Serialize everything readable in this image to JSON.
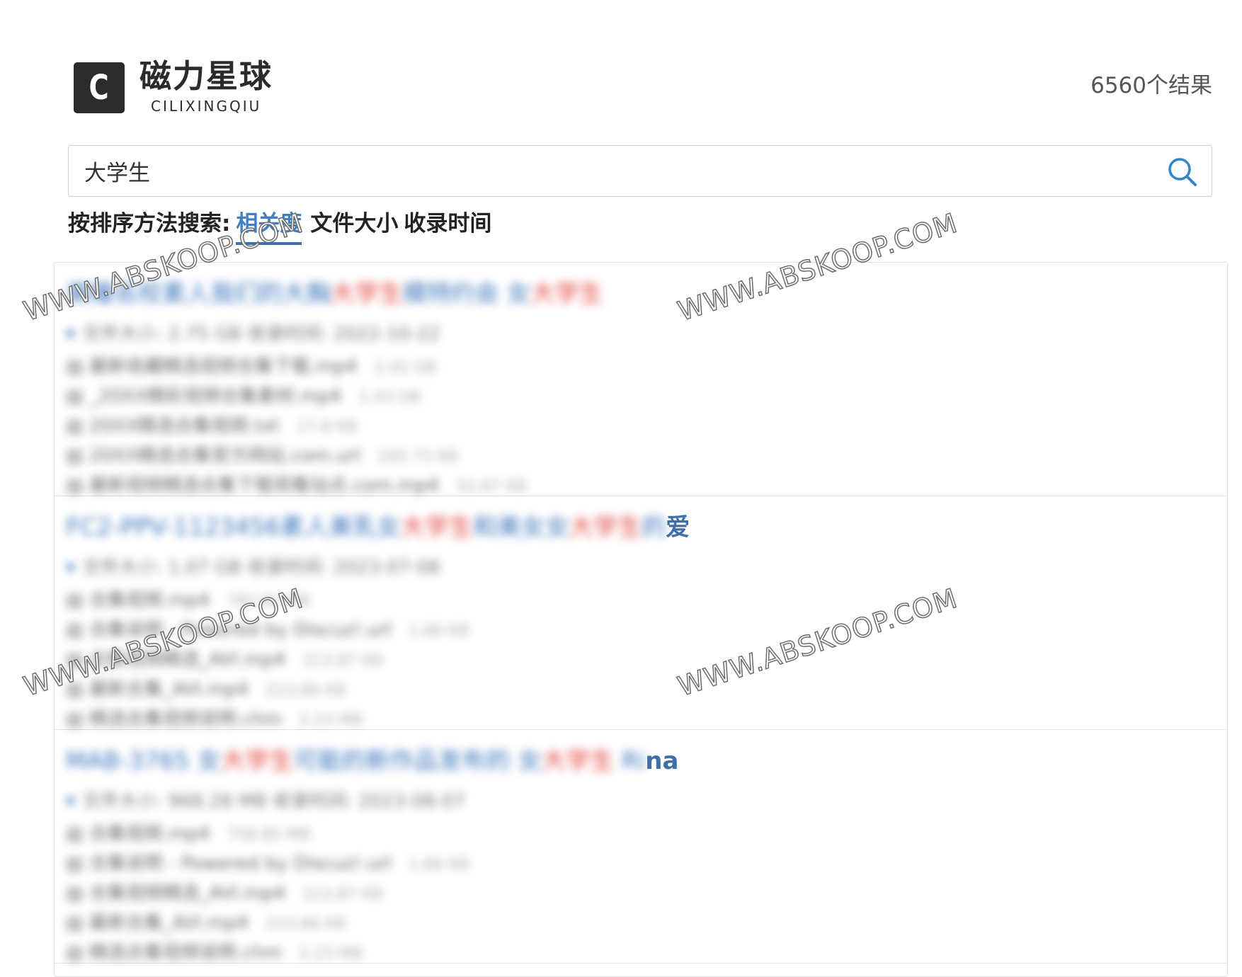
{
  "header": {
    "logo_letter": "C",
    "logo_name_cn": "磁力星球",
    "logo_name_en": "CILIXINGQIU",
    "result_count": "6560个结果"
  },
  "search": {
    "value": "大学生",
    "placeholder": ""
  },
  "sort": {
    "label": "按排序方法搜索:",
    "options": [
      "相关度",
      "文件大小",
      "收录时间"
    ],
    "active": "相关度"
  },
  "results": [
    {
      "title_segments": [
        {
          "text": "美瞳名校素人我们的大胸",
          "style": "blue",
          "blurred": true
        },
        {
          "text": "大学生",
          "style": "red",
          "blurred": true
        },
        {
          "text": "模特约会 女",
          "style": "blue",
          "blurred": true
        },
        {
          "text": "大学生",
          "style": "red",
          "blurred": true
        }
      ],
      "meta": "文件大小: 2.75 GB    收录时间: 2022-10-22",
      "files": [
        {
          "name": "最新收藏精选视频合集下载.mp4",
          "size": "2.42 GB"
        },
        {
          "name": "_20XX精彩视频合集素材.mp4",
          "size": "1.43 GB"
        },
        {
          "name": "20XX精选合集视频.txt",
          "size": "17.8 KB"
        },
        {
          "name": "20XX精选合集官方网站.com.url",
          "size": "245.73 KB"
        },
        {
          "name": "最新视频精选合集下载观看站点.com.mp4",
          "size": "52.67 KB"
        }
      ]
    },
    {
      "title_segments": [
        {
          "text": "FC2-PPV-1123456素人美乳女",
          "style": "blue",
          "blurred": true
        },
        {
          "text": "大学生",
          "style": "red",
          "blurred": true
        },
        {
          "text": "和美女女",
          "style": "blue",
          "blurred": true
        },
        {
          "text": "大学生",
          "style": "red",
          "blurred": true
        },
        {
          "text": "的",
          "style": "blue",
          "blurred": true
        },
        {
          "text": "爱",
          "style": "clear",
          "blurred": false
        }
      ],
      "meta": "文件大小: 1.07 GB    收录时间: 2023-07-08",
      "files": [
        {
          "name": "合集视频.mp4",
          "size": "783.82 MB"
        },
        {
          "name": "合集说明 - Powered by Discuz!.url",
          "size": "1.66 KB"
        },
        {
          "name": "合集视频精选_AVI.mp4",
          "size": "213.87 KB"
        },
        {
          "name": "最新合集_AVI.mp4",
          "size": "213.86 KB"
        },
        {
          "name": "精选合集视频说明.chm",
          "size": "2.23 MB"
        }
      ]
    },
    {
      "title_segments": [
        {
          "text": "MAB-3765 女",
          "style": "blue",
          "blurred": true
        },
        {
          "text": "大学生",
          "style": "red",
          "blurred": true
        },
        {
          "text": "可能的新作品发布的 女",
          "style": "blue",
          "blurred": true
        },
        {
          "text": "大学生",
          "style": "red",
          "blurred": true
        },
        {
          "text": " Ri",
          "style": "blue",
          "blurred": true
        },
        {
          "text": "na",
          "style": "clear",
          "blurred": false
        }
      ],
      "meta": "文件大小: 968.28 MB    收录时间: 2023-08-07",
      "files": [
        {
          "name": "合集视频.mp4",
          "size": "758.85 MB"
        },
        {
          "name": "合集说明 - Powered by Discuz!.url",
          "size": "1.66 KB"
        },
        {
          "name": "合集视频精选_AVI.mp4",
          "size": "213.87 KB"
        },
        {
          "name": "最新合集_AVI.mp4",
          "size": "213.86 KB"
        },
        {
          "name": "精选合集视频说明.chm",
          "size": "2.23 MB"
        }
      ]
    }
  ],
  "watermark_text": "WWW.ABSKOOP.COM",
  "colors": {
    "link_blue": "#3a74bb",
    "highlight_red": "#e0403a",
    "sort_active": "#3f7fc2",
    "search_icon": "#2f86c9"
  },
  "icons": {
    "logo": "logo-icon",
    "search": "search-icon",
    "file": "file-icon"
  }
}
